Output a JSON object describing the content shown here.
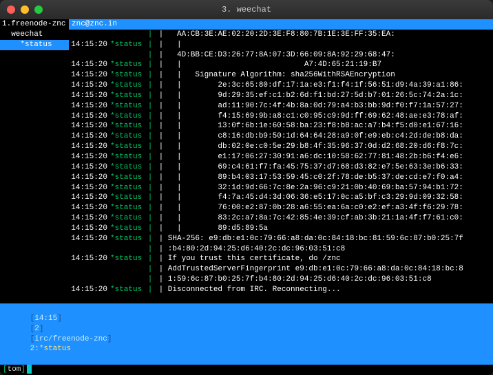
{
  "window": {
    "title": "3. weechat"
  },
  "sidebar": {
    "items": [
      {
        "idx": "1.",
        "name": "freenode-znc",
        "selected": false,
        "indent": 0
      },
      {
        "idx": "",
        "name": "weechat",
        "selected": false,
        "indent": 2
      },
      {
        "idx": "",
        "name": "*status",
        "selected": true,
        "indent": 4
      }
    ]
  },
  "channel": {
    "title": "znc@znc.in"
  },
  "log": [
    {
      "ts": "",
      "nick": "",
      "msg": "|   AA:CB:3E:AE:02:20:2D:3E:F8:80:7B:1E:3E:FF:35:EA:"
    },
    {
      "ts": "14:15:20",
      "nick": "*status",
      "msg": "|   |"
    },
    {
      "ts": "",
      "nick": "",
      "msg": "|   4D:BB:CE:D3:26:77:8A:07:3D:66:09:8A:92:29:68:47:"
    },
    {
      "ts": "14:15:20",
      "nick": "*status",
      "msg": "|   |                           A7:4D:65:21:19:B7"
    },
    {
      "ts": "14:15:20",
      "nick": "*status",
      "msg": "|   |   Signature Algorithm: sha256WithRSAEncryption"
    },
    {
      "ts": "14:15:20",
      "nick": "*status",
      "msg": "|   |        2e:3c:65:80:df:17:1a:e3:f1:f4:1f:56:51:d9:4a:39:a1:86:"
    },
    {
      "ts": "14:15:20",
      "nick": "*status",
      "msg": "|   |        9d:29:35:ef:c1:b2:6d:f1:bd:27:5d:b7:01:26:5c:74:2a:1c:"
    },
    {
      "ts": "14:15:20",
      "nick": "*status",
      "msg": "|   |        ad:11:90:7c:4f:4b:8a:0d:79:a4:b3:bb:9d:f0:f7:1a:57:27:"
    },
    {
      "ts": "14:15:20",
      "nick": "*status",
      "msg": "|   |        f4:15:69:9b:a8:c1:c0:95:c9:9d:ff:69:62:48:ae:e3:78:af:"
    },
    {
      "ts": "14:15:20",
      "nick": "*status",
      "msg": "|   |        13:0f:6b:1e:60:58:ba:23:f8:b8:ac:a7:b4:f5:d0:e1:67:16:"
    },
    {
      "ts": "14:15:20",
      "nick": "*status",
      "msg": "|   |        c8:16:db:b9:50:1d:64:64:28:a9:0f:e9:eb:c4:2d:de:b8:da:"
    },
    {
      "ts": "14:15:20",
      "nick": "*status",
      "msg": "|   |        db:02:0e:c0:5e:29:b8:4f:35:96:37:0d:d2:68:20:d6:f8:7c:"
    },
    {
      "ts": "14:15:20",
      "nick": "*status",
      "msg": "|   |        e1:17:06:27:30:91:a6:dc:10:58:62:77:81:48:2b:b6:f4:e6:"
    },
    {
      "ts": "14:15:20",
      "nick": "*status",
      "msg": "|   |        69:c4:61:f7:fa:45:75:37:d7:68:d3:82:e7:5e:63:3e:b6:33:"
    },
    {
      "ts": "14:15:20",
      "nick": "*status",
      "msg": "|   |        89:b4:03:17:53:59:45:c0:2f:78:de:b5:37:de:cd:e7:f0:a4:"
    },
    {
      "ts": "14:15:20",
      "nick": "*status",
      "msg": "|   |        32:1d:9d:66:7c:8e:2a:96:c9:21:0b:40:69:ba:57:94:b1:72:"
    },
    {
      "ts": "14:15:20",
      "nick": "*status",
      "msg": "|   |        f4:7a:45:d4:3d:06:36:e5:17:0c:a5:bf:c3:29:9d:09:32:58:"
    },
    {
      "ts": "14:15:20",
      "nick": "*status",
      "msg": "|   |        76:00:e2:87:0b:28:a6:55:ea:6a:c0:e2:ef:a3:4f:f6:29:78:"
    },
    {
      "ts": "14:15:20",
      "nick": "*status",
      "msg": "|   |        83:2c:a7:8a:7c:42:85:4e:39:cf:ab:3b:21:1a:4f:f7:61:c0:"
    },
    {
      "ts": "14:15:20",
      "nick": "*status",
      "msg": "|   |        89:d5:89:5a"
    },
    {
      "ts": "14:15:20",
      "nick": "*status",
      "msg": "| SHA-256: e9:db:e1:0c:79:66:a8:da:0c:84:18:bc:81:59:6c:87:b0:25:7f"
    },
    {
      "ts": "",
      "nick": "",
      "msg": "| :b4:80:2d:94:25:d6:40:2c:dc:96:03:51:c8"
    },
    {
      "ts": "14:15:20",
      "nick": "*status",
      "msg": "| If you trust this certificate, do /znc"
    },
    {
      "ts": "",
      "nick": "",
      "msg": "| AddTrustedServerFingerprint e9:db:e1:0c:79:66:a8:da:0c:84:18:bc:8"
    },
    {
      "ts": "",
      "nick": "",
      "msg": "| 1:59:6c:87:b0:25:7f:b4:80:2d:94:25:d6:40:2c:dc:96:03:51:c8"
    },
    {
      "ts": "14:15:20",
      "nick": "*status",
      "msg": "| Disconnected from IRC. Reconnecting..."
    }
  ],
  "statusbar": {
    "time": "14:15",
    "segA": "2",
    "net": "irc/freenode-znc",
    "buf_idx": "2:",
    "buf_name": "*status"
  },
  "input": {
    "user": "tom"
  }
}
